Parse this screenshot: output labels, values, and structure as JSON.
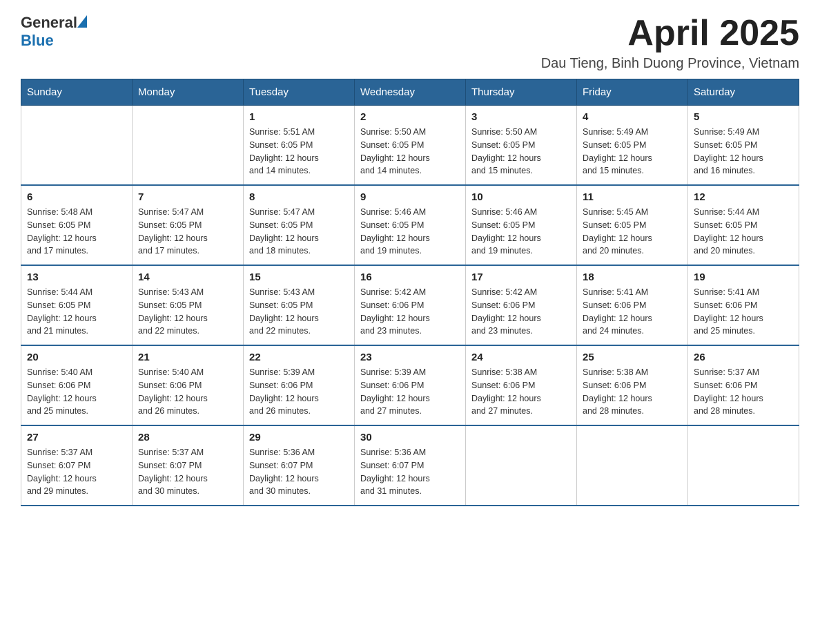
{
  "header": {
    "logo_general": "General",
    "logo_blue": "Blue",
    "month_year": "April 2025",
    "location": "Dau Tieng, Binh Duong Province, Vietnam"
  },
  "days_of_week": [
    "Sunday",
    "Monday",
    "Tuesday",
    "Wednesday",
    "Thursday",
    "Friday",
    "Saturday"
  ],
  "weeks": [
    [
      {
        "day": "",
        "info": ""
      },
      {
        "day": "",
        "info": ""
      },
      {
        "day": "1",
        "info": "Sunrise: 5:51 AM\nSunset: 6:05 PM\nDaylight: 12 hours\nand 14 minutes."
      },
      {
        "day": "2",
        "info": "Sunrise: 5:50 AM\nSunset: 6:05 PM\nDaylight: 12 hours\nand 14 minutes."
      },
      {
        "day": "3",
        "info": "Sunrise: 5:50 AM\nSunset: 6:05 PM\nDaylight: 12 hours\nand 15 minutes."
      },
      {
        "day": "4",
        "info": "Sunrise: 5:49 AM\nSunset: 6:05 PM\nDaylight: 12 hours\nand 15 minutes."
      },
      {
        "day": "5",
        "info": "Sunrise: 5:49 AM\nSunset: 6:05 PM\nDaylight: 12 hours\nand 16 minutes."
      }
    ],
    [
      {
        "day": "6",
        "info": "Sunrise: 5:48 AM\nSunset: 6:05 PM\nDaylight: 12 hours\nand 17 minutes."
      },
      {
        "day": "7",
        "info": "Sunrise: 5:47 AM\nSunset: 6:05 PM\nDaylight: 12 hours\nand 17 minutes."
      },
      {
        "day": "8",
        "info": "Sunrise: 5:47 AM\nSunset: 6:05 PM\nDaylight: 12 hours\nand 18 minutes."
      },
      {
        "day": "9",
        "info": "Sunrise: 5:46 AM\nSunset: 6:05 PM\nDaylight: 12 hours\nand 19 minutes."
      },
      {
        "day": "10",
        "info": "Sunrise: 5:46 AM\nSunset: 6:05 PM\nDaylight: 12 hours\nand 19 minutes."
      },
      {
        "day": "11",
        "info": "Sunrise: 5:45 AM\nSunset: 6:05 PM\nDaylight: 12 hours\nand 20 minutes."
      },
      {
        "day": "12",
        "info": "Sunrise: 5:44 AM\nSunset: 6:05 PM\nDaylight: 12 hours\nand 20 minutes."
      }
    ],
    [
      {
        "day": "13",
        "info": "Sunrise: 5:44 AM\nSunset: 6:05 PM\nDaylight: 12 hours\nand 21 minutes."
      },
      {
        "day": "14",
        "info": "Sunrise: 5:43 AM\nSunset: 6:05 PM\nDaylight: 12 hours\nand 22 minutes."
      },
      {
        "day": "15",
        "info": "Sunrise: 5:43 AM\nSunset: 6:05 PM\nDaylight: 12 hours\nand 22 minutes."
      },
      {
        "day": "16",
        "info": "Sunrise: 5:42 AM\nSunset: 6:06 PM\nDaylight: 12 hours\nand 23 minutes."
      },
      {
        "day": "17",
        "info": "Sunrise: 5:42 AM\nSunset: 6:06 PM\nDaylight: 12 hours\nand 23 minutes."
      },
      {
        "day": "18",
        "info": "Sunrise: 5:41 AM\nSunset: 6:06 PM\nDaylight: 12 hours\nand 24 minutes."
      },
      {
        "day": "19",
        "info": "Sunrise: 5:41 AM\nSunset: 6:06 PM\nDaylight: 12 hours\nand 25 minutes."
      }
    ],
    [
      {
        "day": "20",
        "info": "Sunrise: 5:40 AM\nSunset: 6:06 PM\nDaylight: 12 hours\nand 25 minutes."
      },
      {
        "day": "21",
        "info": "Sunrise: 5:40 AM\nSunset: 6:06 PM\nDaylight: 12 hours\nand 26 minutes."
      },
      {
        "day": "22",
        "info": "Sunrise: 5:39 AM\nSunset: 6:06 PM\nDaylight: 12 hours\nand 26 minutes."
      },
      {
        "day": "23",
        "info": "Sunrise: 5:39 AM\nSunset: 6:06 PM\nDaylight: 12 hours\nand 27 minutes."
      },
      {
        "day": "24",
        "info": "Sunrise: 5:38 AM\nSunset: 6:06 PM\nDaylight: 12 hours\nand 27 minutes."
      },
      {
        "day": "25",
        "info": "Sunrise: 5:38 AM\nSunset: 6:06 PM\nDaylight: 12 hours\nand 28 minutes."
      },
      {
        "day": "26",
        "info": "Sunrise: 5:37 AM\nSunset: 6:06 PM\nDaylight: 12 hours\nand 28 minutes."
      }
    ],
    [
      {
        "day": "27",
        "info": "Sunrise: 5:37 AM\nSunset: 6:07 PM\nDaylight: 12 hours\nand 29 minutes."
      },
      {
        "day": "28",
        "info": "Sunrise: 5:37 AM\nSunset: 6:07 PM\nDaylight: 12 hours\nand 30 minutes."
      },
      {
        "day": "29",
        "info": "Sunrise: 5:36 AM\nSunset: 6:07 PM\nDaylight: 12 hours\nand 30 minutes."
      },
      {
        "day": "30",
        "info": "Sunrise: 5:36 AM\nSunset: 6:07 PM\nDaylight: 12 hours\nand 31 minutes."
      },
      {
        "day": "",
        "info": ""
      },
      {
        "day": "",
        "info": ""
      },
      {
        "day": "",
        "info": ""
      }
    ]
  ]
}
